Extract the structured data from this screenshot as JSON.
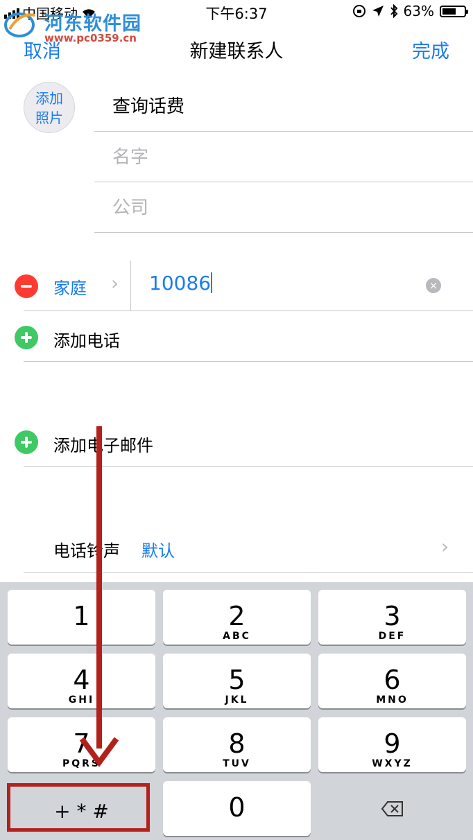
{
  "status_bar": {
    "carrier": "中国移动",
    "time": "下午6:37",
    "battery": "63%",
    "battery_level": 0.63
  },
  "watermark": {
    "text": "河东软件园",
    "url": "www.pc0359.cn"
  },
  "nav": {
    "cancel": "取消",
    "title": "新建联系人",
    "done": "完成"
  },
  "photo": {
    "line1": "添加",
    "line2": "照片"
  },
  "fields": {
    "last_name": "查询话费",
    "first_name_placeholder": "名字",
    "company_placeholder": "公司"
  },
  "phone": {
    "label": "家庭",
    "value": "10086"
  },
  "add_phone": "添加电话",
  "add_email": "添加电子邮件",
  "ringtone": {
    "label": "电话铃声",
    "value": "默认"
  },
  "keypad": {
    "keys": [
      {
        "num": "1",
        "letters": ""
      },
      {
        "num": "2",
        "letters": "ABC"
      },
      {
        "num": "3",
        "letters": "DEF"
      },
      {
        "num": "4",
        "letters": "GHI"
      },
      {
        "num": "5",
        "letters": "JKL"
      },
      {
        "num": "6",
        "letters": "MNO"
      },
      {
        "num": "7",
        "letters": "PQRS"
      },
      {
        "num": "8",
        "letters": "TUV"
      },
      {
        "num": "9",
        "letters": "WXYZ"
      },
      {
        "num": "0",
        "letters": ""
      }
    ],
    "symbols": "+ * #",
    "delete_icon": "backspace-icon"
  },
  "colors": {
    "accent": "#1a7cf0",
    "minus": "#fe3b30",
    "plus": "#3fc964",
    "annotation": "#b3211d"
  }
}
